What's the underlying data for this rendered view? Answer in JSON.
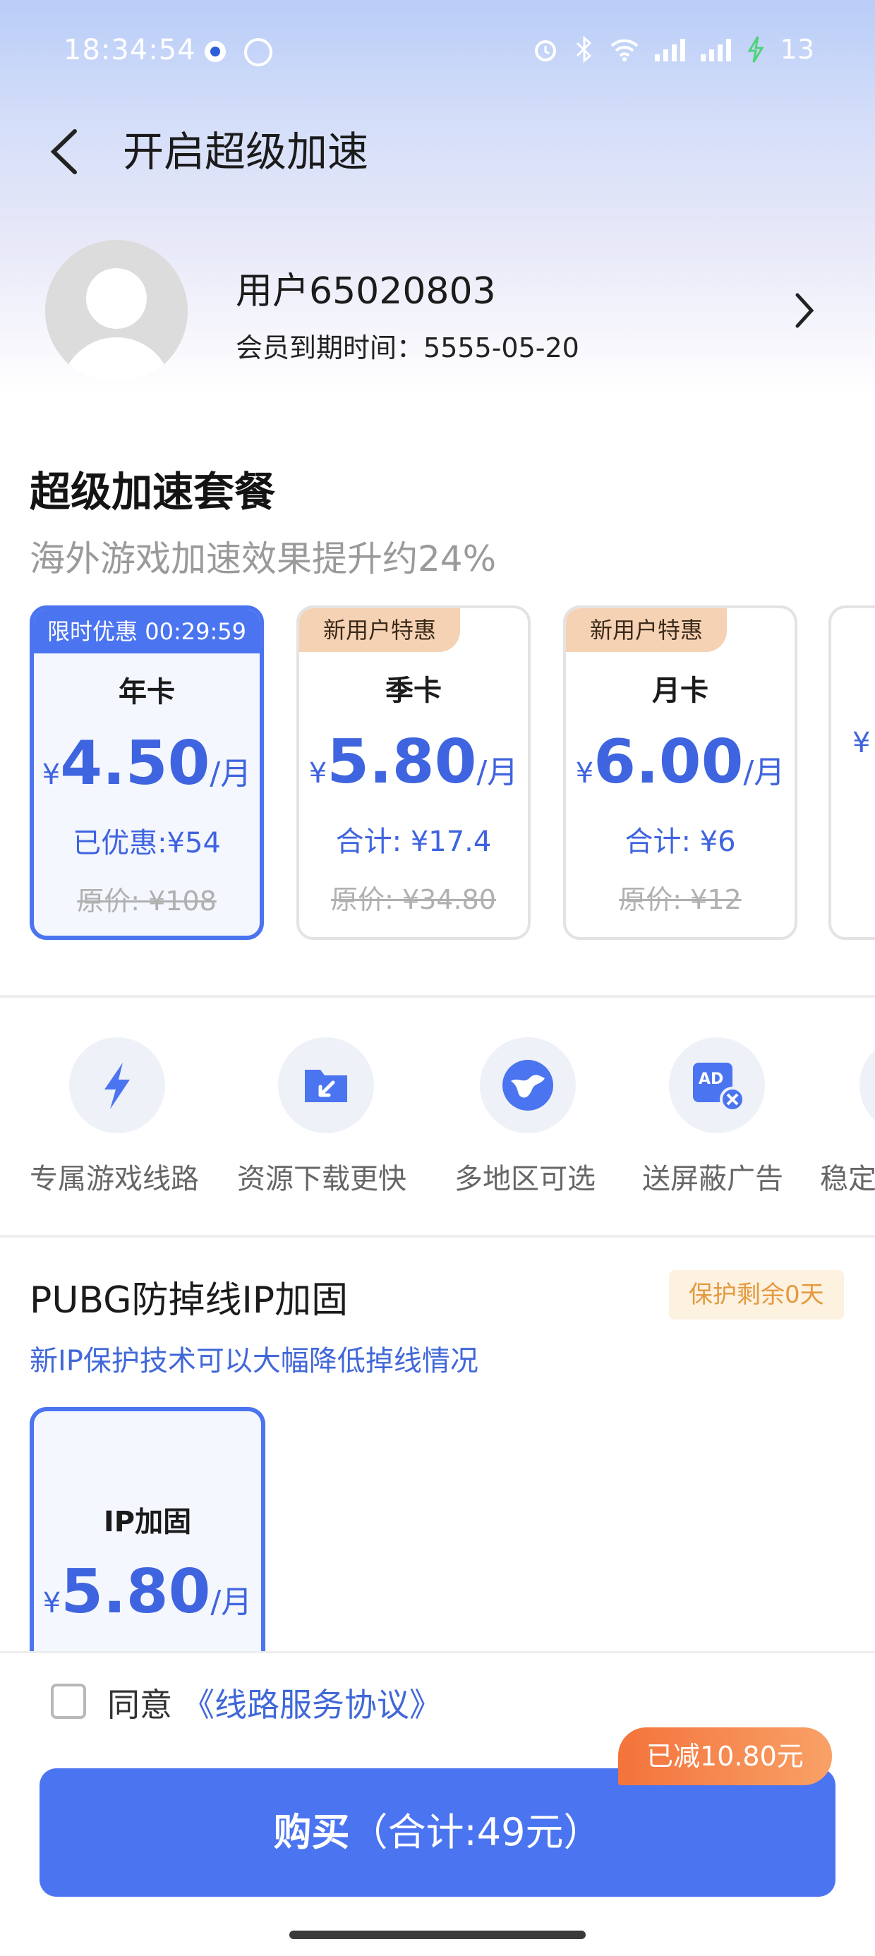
{
  "status_bar": {
    "time": "18:34:54",
    "battery": "13",
    "icons": [
      "notification-dot-icon",
      "compass-icon",
      "alarm-icon",
      "bluetooth-icon",
      "wifi-icon",
      "signal-icon",
      "signal-icon",
      "charging-icon"
    ]
  },
  "nav": {
    "title": "开启超级加速",
    "back_icon": "chevron-left-icon"
  },
  "profile": {
    "name": "用户65020803",
    "expire_label": "会员到期时间：",
    "expire_date": "5555-05-20"
  },
  "package_section": {
    "title": "超级加速套餐",
    "subtitle": "海外游戏加速效果提升约24%",
    "plans": [
      {
        "badge": "限时优惠 00:29:59",
        "name": "年卡",
        "currency": "¥",
        "price": "4.50",
        "unit": "/月",
        "total": "已优惠:¥54",
        "original": "原价: ¥108",
        "selected": true
      },
      {
        "badge": "新用户特惠",
        "name": "季卡",
        "currency": "¥",
        "price": "5.80",
        "unit": "/月",
        "total": "合计: ¥17.4",
        "original": "原价: ¥34.80",
        "selected": false
      },
      {
        "badge": "新用户特惠",
        "name": "月卡",
        "currency": "¥",
        "price": "6.00",
        "unit": "/月",
        "total": "合计: ¥6",
        "original": "原价: ¥12",
        "selected": false
      },
      {
        "badge": "",
        "name": "",
        "currency": "¥",
        "price": "",
        "unit": "",
        "total": "",
        "original": "",
        "selected": false
      }
    ]
  },
  "features": [
    {
      "label": "专属游戏线路",
      "icon": "lightning-icon"
    },
    {
      "label": "资源下载更快",
      "icon": "download-folder-icon"
    },
    {
      "label": "多地区可选",
      "icon": "globe-icon"
    },
    {
      "label": "送屏蔽广告",
      "icon": "ad-block-icon"
    },
    {
      "label": "稳定",
      "icon": "stable-icon"
    }
  ],
  "pubg": {
    "title": "PUBG防掉线IP加固",
    "badge": "保护剩余0天",
    "subtitle": "新IP保护技术可以大幅降低掉线情况",
    "card": {
      "name": "IP加固",
      "currency": "¥",
      "price": "5.80",
      "unit": "/月"
    }
  },
  "agreement": {
    "prefix": "同意",
    "link": "《线路服务协议》"
  },
  "buy": {
    "label": "购买",
    "total": "（合计:49元）",
    "discount": "已减10.80元"
  },
  "colors": {
    "accent": "#4b74f0",
    "price": "#3f64df",
    "badge_orange": "#f6d2b4",
    "warn": "#e49a3f"
  }
}
